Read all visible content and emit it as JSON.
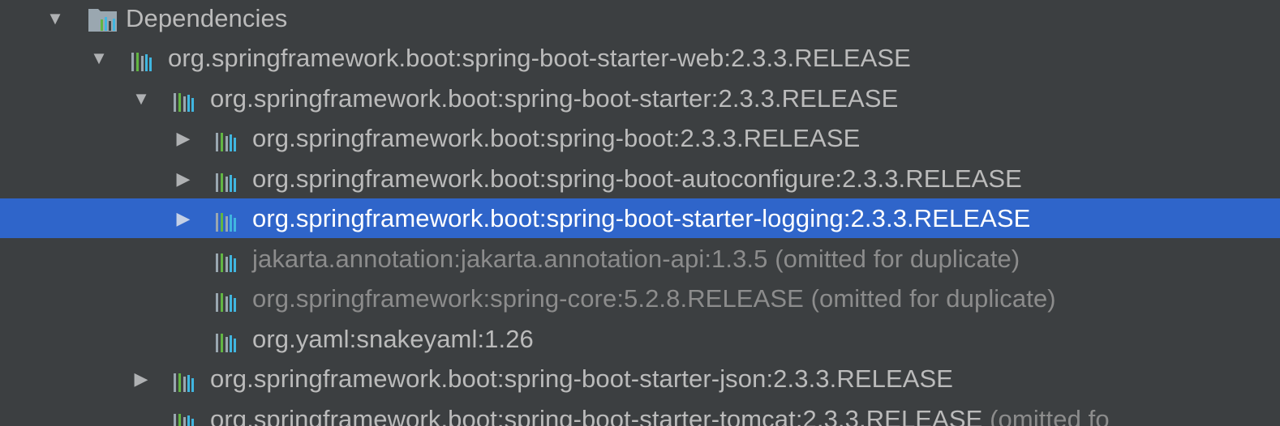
{
  "tree": {
    "root": {
      "label": "Dependencies",
      "icon": "folder-icon",
      "expanded": true
    },
    "items": [
      {
        "label": "org.springframework.boot:spring-boot-starter-web:2.3.3.RELEASE",
        "note": "",
        "toggle": "expanded",
        "selected": false,
        "omitted": false
      },
      {
        "label": "org.springframework.boot:spring-boot-starter:2.3.3.RELEASE",
        "note": "",
        "toggle": "expanded",
        "selected": false,
        "omitted": false
      },
      {
        "label": "org.springframework.boot:spring-boot:2.3.3.RELEASE",
        "note": "",
        "toggle": "collapsed",
        "selected": false,
        "omitted": false
      },
      {
        "label": "org.springframework.boot:spring-boot-autoconfigure:2.3.3.RELEASE",
        "note": "",
        "toggle": "collapsed",
        "selected": false,
        "omitted": false
      },
      {
        "label": "org.springframework.boot:spring-boot-starter-logging:2.3.3.RELEASE",
        "note": "",
        "toggle": "collapsed",
        "selected": true,
        "omitted": false
      },
      {
        "label": "jakarta.annotation:jakarta.annotation-api:1.3.5",
        "note": "(omitted for duplicate)",
        "toggle": "none",
        "selected": false,
        "omitted": true
      },
      {
        "label": "org.springframework:spring-core:5.2.8.RELEASE",
        "note": "(omitted for duplicate)",
        "toggle": "none",
        "selected": false,
        "omitted": true
      },
      {
        "label": "org.yaml:snakeyaml:1.26",
        "note": "",
        "toggle": "none",
        "selected": false,
        "omitted": false
      },
      {
        "label": "org.springframework.boot:spring-boot-starter-json:2.3.3.RELEASE",
        "note": "",
        "toggle": "collapsed",
        "selected": false,
        "omitted": false
      },
      {
        "label": "org.springframework.boot:spring-boot-starter-tomcat:2.3.3.RELEASE",
        "note": "(omitted fo",
        "toggle": "none",
        "selected": false,
        "omitted": false
      }
    ]
  },
  "icons": {
    "library": "library-icon",
    "expanded": "▼",
    "collapsed": "▶"
  },
  "colors": {
    "background": "#3c3f41",
    "selection": "#2f65ca",
    "text": "#bbbbbb",
    "muted": "#8c8c8c",
    "lib_green": "#62b543",
    "lib_blue": "#40b6e0",
    "lib_gray": "#9aa7b0"
  }
}
